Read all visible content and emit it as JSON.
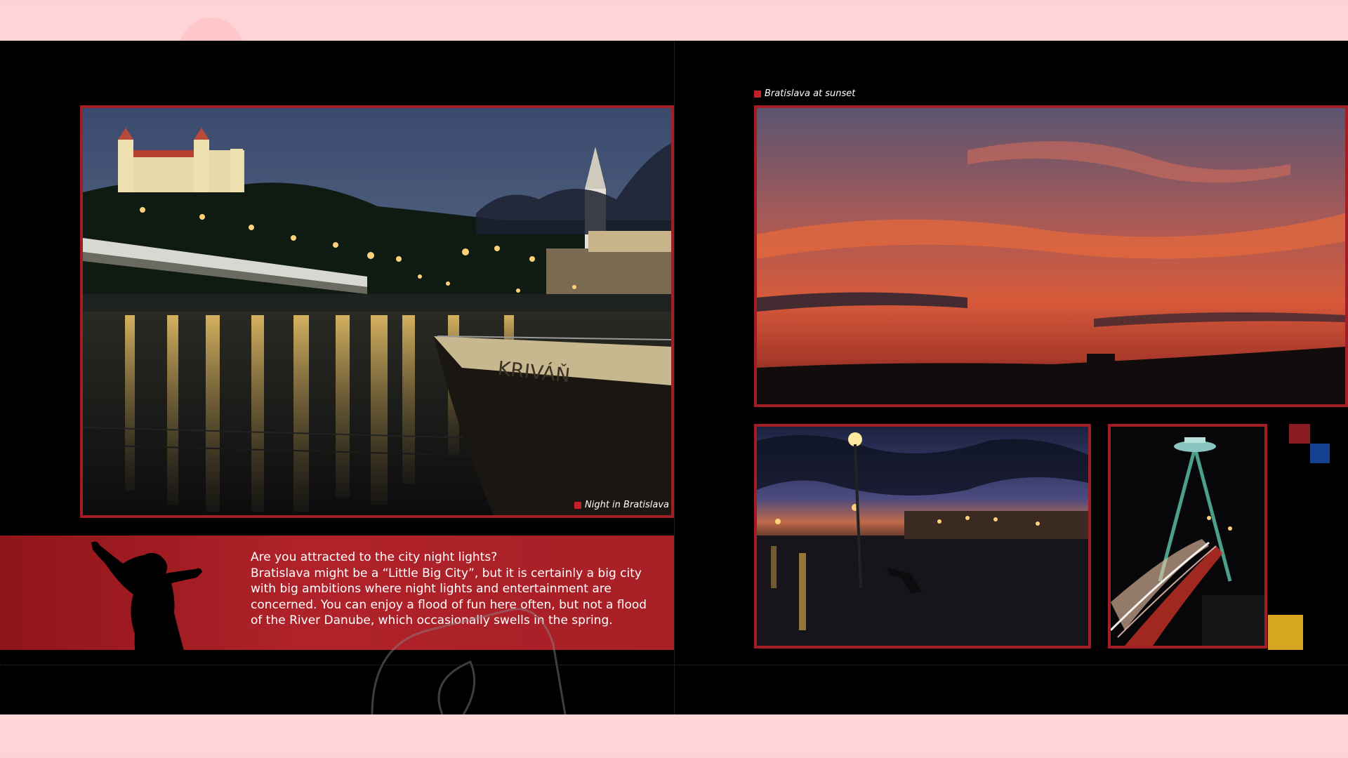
{
  "captions": {
    "night": "Night in Bratislava",
    "sunset": "Bratislava at sunset"
  },
  "photo_text": {
    "boat_name": "KRIVÁŇ"
  },
  "band": {
    "lines": [
      "Are you attracted to the city night lights?",
      "Bratislava might be a “Little Big City”, but it is certainly a big city",
      "with big ambitions where night lights and entertainment are",
      "concerned. You can enjoy a flood of fun here often, but not a flood",
      "of the River Danube, which occasionally swells in the spring."
    ]
  },
  "colors": {
    "accent_red": "#a31d24",
    "band_red": "#b0222a",
    "square_red": "#8a1a22",
    "square_blue": "#15408e",
    "square_yellow": "#d6a621",
    "viewer_pink": "#ffd9dc"
  }
}
